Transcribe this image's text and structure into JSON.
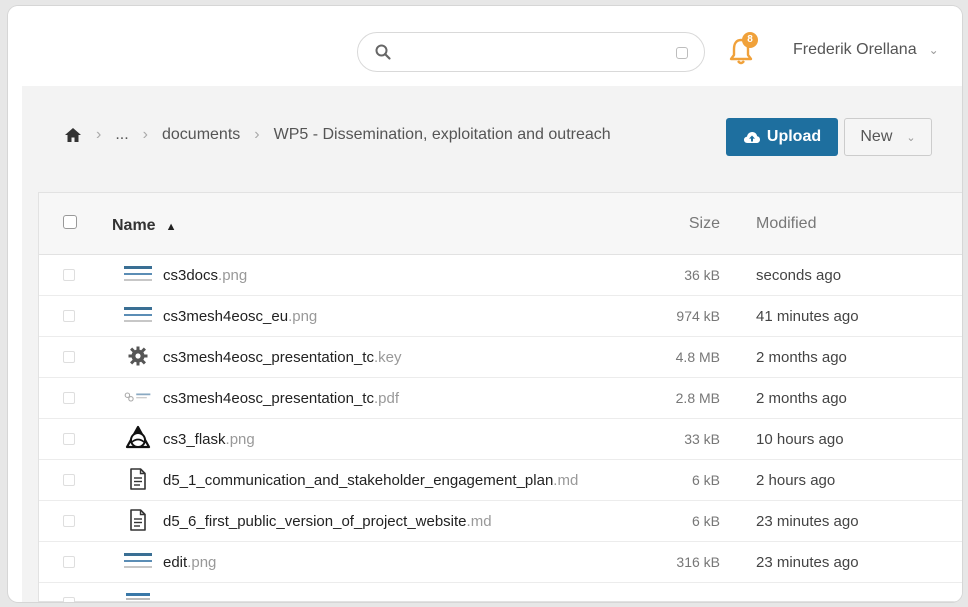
{
  "header": {
    "search_placeholder": "",
    "notification_count": "8",
    "user_name": "Frederik Orellana"
  },
  "breadcrumb": {
    "ellipsis": "...",
    "items": [
      "documents",
      "WP5 - Dissemination, exploitation and outreach"
    ]
  },
  "toolbar": {
    "upload_label": "Upload",
    "new_label": "New"
  },
  "table": {
    "columns": {
      "name": "Name",
      "size": "Size",
      "modified": "Modified"
    },
    "rows": [
      {
        "base": "cs3docs",
        "ext": ".png",
        "size": "36 kB",
        "modified": "seconds ago",
        "icon": "image-thumbnail-icon"
      },
      {
        "base": "cs3mesh4eosc_eu",
        "ext": ".png",
        "size": "974 kB",
        "modified": "41 minutes ago",
        "icon": "image-thumbnail-icon"
      },
      {
        "base": "cs3mesh4eosc_presentation_tc",
        "ext": ".key",
        "size": "4.8 MB",
        "modified": "2 months ago",
        "icon": "gear-icon"
      },
      {
        "base": "cs3mesh4eosc_presentation_tc",
        "ext": ".pdf",
        "size": "2.8 MB",
        "modified": "2 months ago",
        "icon": "pdf-thumbnail-icon"
      },
      {
        "base": "cs3_flask",
        "ext": ".png",
        "size": "33 kB",
        "modified": "10 hours ago",
        "icon": "flask-logo-icon"
      },
      {
        "base": "d5_1_communication_and_stakeholder_engagement_plan",
        "ext": ".md",
        "size": "6 kB",
        "modified": "2 hours ago",
        "icon": "document-icon"
      },
      {
        "base": "d5_6_first_public_version_of_project_website",
        "ext": ".md",
        "size": "6 kB",
        "modified": "23 minutes ago",
        "icon": "document-icon"
      },
      {
        "base": "edit",
        "ext": ".png",
        "size": "316 kB",
        "modified": "23 minutes ago",
        "icon": "image-thumbnail-icon"
      }
    ]
  },
  "colors": {
    "primary": "#1e6f9f",
    "notification": "#f0a13a"
  }
}
